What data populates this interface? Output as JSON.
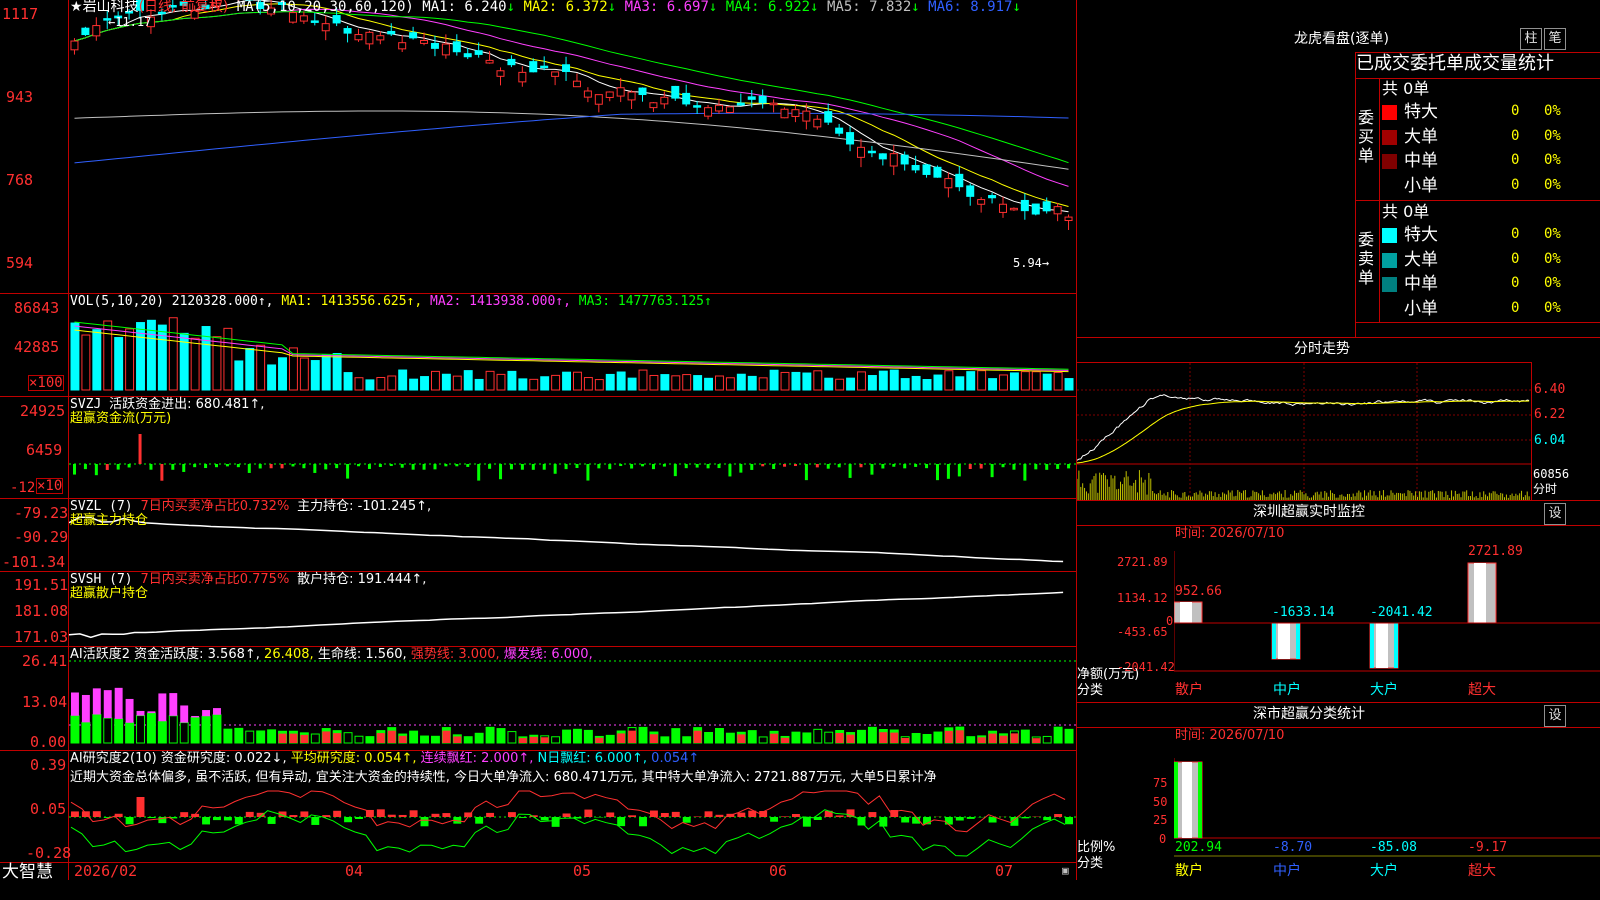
{
  "stock": {
    "name": "岩山科技",
    "period": "(日线, 前复权)",
    "ma_params": "MA(5,10,20,30,60,120)"
  },
  "ma": [
    {
      "label": "MA1: 6.240",
      "arrow": "↓",
      "color": "#ffffff"
    },
    {
      "label": "MA2: 6.372",
      "arrow": "↓",
      "color": "#ffff00"
    },
    {
      "label": "MA3: 6.697",
      "arrow": "↓",
      "color": "#ff40ff"
    },
    {
      "label": "MA4: 6.922",
      "arrow": "↓",
      "color": "#00ff00"
    },
    {
      "label": "MA5: 7.832",
      "arrow": "↓",
      "color": "#c0c0c0"
    },
    {
      "label": "MA6: 8.917",
      "arrow": "↓",
      "color": "#3060ff"
    }
  ],
  "price_axis": [
    "1117",
    "943",
    "768",
    "594"
  ],
  "price_max_label": "11.17",
  "price_min_label": "5.94→",
  "vol_panel": {
    "title": "VOL(5,10,20)",
    "value": "2120328.000↑,",
    "ma1": "MA1: 1413556.625↑,",
    "ma2": "MA2: 1413938.000↑,",
    "ma3": "MA3: 1477763.125↑",
    "axis": [
      "86843",
      "42885"
    ],
    "unit": "×100"
  },
  "svzj": {
    "name": "SVZJ",
    "text": "活跃资金进出: 680.481↑,",
    "subtitle": "超赢资金流(万元)",
    "axis": [
      "24925",
      "6459",
      "-12"
    ],
    "unit": "×10"
  },
  "svzl": {
    "name": "SVZL (7)",
    "ratio": "7日内买卖净占比0.732%",
    "holding": "主力持仓: -101.245↑,",
    "subtitle": "超赢主力持仓",
    "axis": [
      "-79.23",
      "-90.29",
      "-101.34"
    ]
  },
  "svsh": {
    "name": "SVSH (7)",
    "ratio": "7日内买卖净占比0.775%",
    "holding": "散户持仓: 191.444↑,",
    "subtitle": "超赢散户持仓",
    "axis": [
      "191.51",
      "181.08",
      "171.03"
    ]
  },
  "ai_active": {
    "name": "AI活跃度2",
    "l1": "资金活跃度: 3.568↑,",
    "l2": "26.408,",
    "l3": "生命线: 1.560,",
    "l4": "强势线: 3.000,",
    "l5": "爆发线: 6.000,",
    "axis": [
      "26.41",
      "13.04",
      "0.00"
    ]
  },
  "ai_research": {
    "name": "AI研究度2(10)",
    "l1": "资金研究度: 0.022↓,",
    "l2": "平均研究度: 0.054↑,",
    "l3": "连续飘红: 2.000↑,",
    "l4": "N日飘红: 6.000↑,",
    "l5": "0.054↑",
    "comment": "近期大资金总体偏多, 虽不活跃, 但有异动, 宜关注大资金的持续性, 今日大单净流入: 680.471万元, 其中特大单净流入: 2721.887万元, 大单5日累计净",
    "axis": [
      "0.39",
      "0.05",
      "-0.28"
    ]
  },
  "bottom_bar": {
    "logo": "大智慧",
    "dates": [
      "2026/02",
      "04",
      "05",
      "06",
      "07"
    ]
  },
  "lhb": {
    "title": "龙虎看盘(逐单)",
    "btn1": "柱",
    "btn2": "笔",
    "header": "已成交委托单成交量统计",
    "buy": {
      "label": "委买单",
      "count": "共 0单",
      "rows": [
        {
          "name": "特大",
          "val": "0",
          "pct": "0%",
          "color": "#ff0000"
        },
        {
          "name": "大单",
          "val": "0",
          "pct": "0%",
          "color": "#a00000"
        },
        {
          "name": "中单",
          "val": "0",
          "pct": "0%",
          "color": "#800000"
        },
        {
          "name": "小单",
          "val": "0",
          "pct": "0%",
          "color": "#000000"
        }
      ]
    },
    "sell": {
      "label": "委卖单",
      "count": "共 0单",
      "rows": [
        {
          "name": "特大",
          "val": "0",
          "pct": "0%",
          "color": "#00ffff"
        },
        {
          "name": "大单",
          "val": "0",
          "pct": "0%",
          "color": "#00a0a0"
        },
        {
          "name": "中单",
          "val": "0",
          "pct": "0%",
          "color": "#008080"
        },
        {
          "name": "小单",
          "val": "0",
          "pct": "0%",
          "color": "#000000"
        }
      ]
    }
  },
  "intraday": {
    "title": "分时走势",
    "axis": [
      "6.40",
      "6.22",
      "6.04"
    ],
    "vol_label": "60856",
    "vol_unit": "分时"
  },
  "sz_monitor": {
    "title": "深圳超赢实时监控",
    "btn": "设",
    "time": "时间: 2026/07/10",
    "axis": [
      "2721.89",
      "1134.12",
      "0",
      "-453.65",
      "-2041.42"
    ],
    "ylabel": "净额(万元)",
    "xlabel": "分类",
    "bars": [
      {
        "name": "散户",
        "value": "952.66"
      },
      {
        "name": "中户",
        "value": "-1633.14"
      },
      {
        "name": "大户",
        "value": "-2041.42"
      },
      {
        "name": "超大",
        "value": "2721.89"
      }
    ]
  },
  "sz_class": {
    "title": "深市超赢分类统计",
    "btn": "设",
    "time": "时间: 2026/07/10",
    "axis": [
      "75",
      "50",
      "25",
      "0"
    ],
    "ylabel": "比例%",
    "xlabel": "分类",
    "bars": [
      {
        "name": "散户",
        "value": "202.94"
      },
      {
        "name": "中户",
        "value": "-8.70"
      },
      {
        "name": "大户",
        "value": "-85.08"
      },
      {
        "name": "超大",
        "value": "-9.17"
      }
    ]
  }
}
